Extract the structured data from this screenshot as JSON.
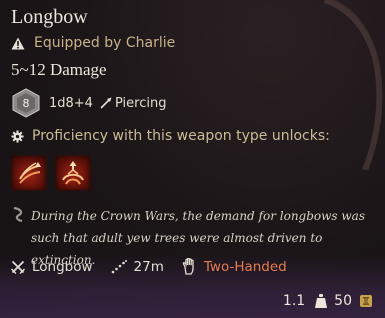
{
  "item": {
    "name": "Longbow",
    "equipped_text": "Equipped by Charlie",
    "damage_text": "5~12 Damage",
    "die_label": "8",
    "damage_roll": "1d8+4",
    "damage_type": "Piercing",
    "proficiency_text": "Proficiency with this weapon type unlocks:",
    "flavor_text": "During the Crown Wars, the demand for longbows was such that adult yew trees were almost driven to extinction.",
    "properties": [
      {
        "icon": "crossed-weapons-icon",
        "label": "Longbow"
      },
      {
        "icon": "range-dots-icon",
        "label": "27m"
      },
      {
        "icon": "hand-icon",
        "label": "Two-Handed"
      }
    ],
    "weight": "1.1",
    "value": "50"
  },
  "colors": {
    "background": "#1b1517",
    "equipped": "#c9b48a",
    "two_handed": "#e67c52",
    "ability_red": "#a02414",
    "gold": "#c8a24a"
  }
}
